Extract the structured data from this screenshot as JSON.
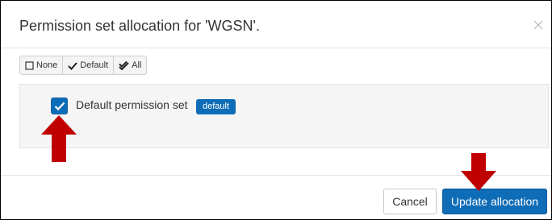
{
  "dialog": {
    "title": "Permission set allocation for 'WGSN'."
  },
  "selection_toolbar": {
    "none_label": "None",
    "default_label": "Default",
    "all_label": "All"
  },
  "permission_sets": [
    {
      "label": "Default permission set",
      "badge": "default",
      "checked": true
    }
  ],
  "footer": {
    "cancel_label": "Cancel",
    "update_label": "Update allocation"
  },
  "colors": {
    "primary": "#0f6cb6",
    "checkbox": "#0b6db8",
    "annotation_arrow": "#c00000",
    "panel_bg": "#f5f5f5"
  },
  "icons": {
    "close": "close-icon",
    "none": "square-outline-icon",
    "default": "checkmark-icon",
    "all": "double-check-icon",
    "annotation": "red-arrow-down/up-icon"
  }
}
